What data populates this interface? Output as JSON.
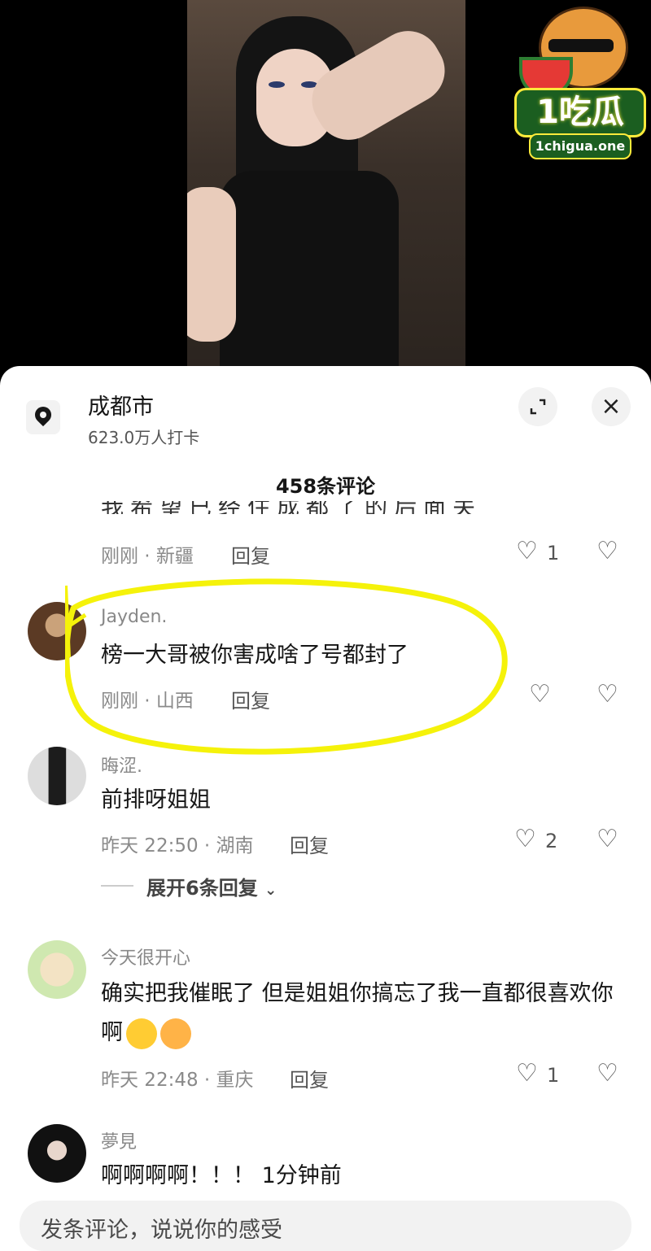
{
  "watermark": {
    "brand": "1吃瓜",
    "url": "1chigua.one"
  },
  "sheet": {
    "location_name": "成都市",
    "location_sub": "623.0万人打卡",
    "comment_count": "458条评论",
    "expand_icon": "expand-icon",
    "close_icon": "×"
  },
  "comments": [
    {
      "id": "c0",
      "text_cut": "我希望已经住成都了的后面关了了吧",
      "time_loc": "刚刚 · 新疆",
      "reply": "回复",
      "likes": "1"
    },
    {
      "id": "c1",
      "name": "Jayden.",
      "text": "榜一大哥被你害成啥了号都封了",
      "time_loc": "刚刚 · 山西",
      "reply": "回复",
      "likes": ""
    },
    {
      "id": "c2",
      "name": "晦涩.",
      "text": "前排呀姐姐",
      "time_loc": "昨天 22:50 · 湖南",
      "reply": "回复",
      "likes": "2",
      "expand": "展开6条回复"
    },
    {
      "id": "c3",
      "name": "今天很开心",
      "text": "确实把我催眠了 但是姐姐你搞忘了我一直都很喜欢你啊",
      "time_loc": "昨天 22:48 · 重庆",
      "reply": "回复",
      "likes": "1"
    },
    {
      "id": "c4",
      "name": "夢見",
      "text": "啊啊啊啊！！！ 1分钟前"
    }
  ],
  "input": {
    "placeholder": "发条评论，说说你的感受"
  },
  "colors": {
    "highlight": "#f5f20a",
    "sheet_bg": "#ffffff",
    "input_bg": "#f2f2f2"
  }
}
